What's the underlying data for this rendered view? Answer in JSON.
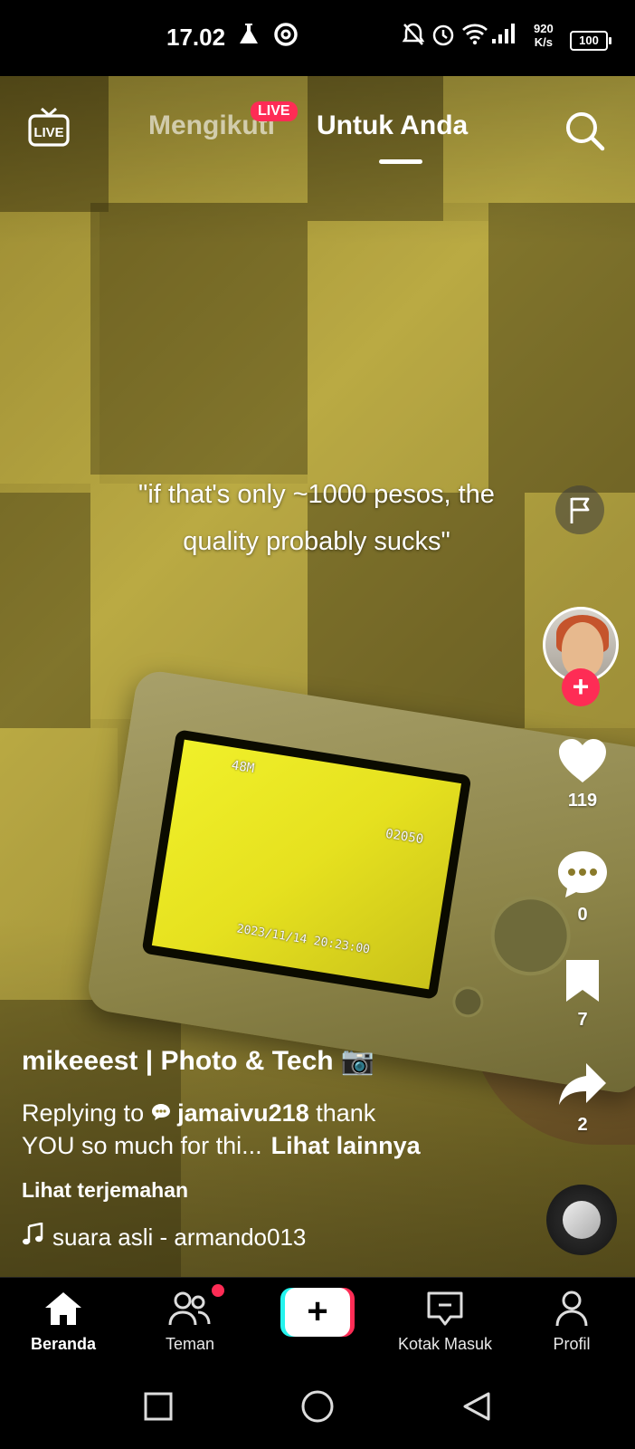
{
  "status_bar": {
    "time": "17.02",
    "net_speed_value": "920",
    "net_speed_unit": "K/s",
    "battery": "100",
    "icons": [
      "lab-flask-icon",
      "at-sign-icon",
      "notifications-off-icon",
      "alarm-icon",
      "wifi-icon",
      "signal-icon"
    ]
  },
  "top_nav": {
    "live_icon_label": "LIVE",
    "tab_following": "Mengikuti",
    "live_badge": "LIVE",
    "tab_for_you": "Untuk Anda",
    "search_icon": "search-icon"
  },
  "video": {
    "caption_line1": "\"if that's only ~1000 pesos, the",
    "caption_line2": "quality probably sucks\"",
    "camera_osd": {
      "counter": "02050",
      "date": "2023/11/14 20:23:00",
      "res": "48M"
    }
  },
  "actions": {
    "likes": "119",
    "comments": "0",
    "bookmarks": "7",
    "shares": "2",
    "follow_label": "+"
  },
  "post": {
    "username": "mikeeest | Photo & Tech 📷",
    "reply_prefix": "Replying to ",
    "reply_user": "jamaivu218",
    "desc_rest": " thank",
    "desc_line2": "YOU so much for thi...",
    "see_more": "Lihat lainnya",
    "translate": "Lihat terjemahan",
    "sound": "suara asli - armando013"
  },
  "bottom_nav": {
    "home": "Beranda",
    "friends": "Teman",
    "create": "+",
    "inbox": "Kotak Masuk",
    "profile": "Profil"
  },
  "colors": {
    "accent_red": "#fe2c55",
    "accent_cyan": "#25f4ee",
    "video_bg": "#968735"
  }
}
